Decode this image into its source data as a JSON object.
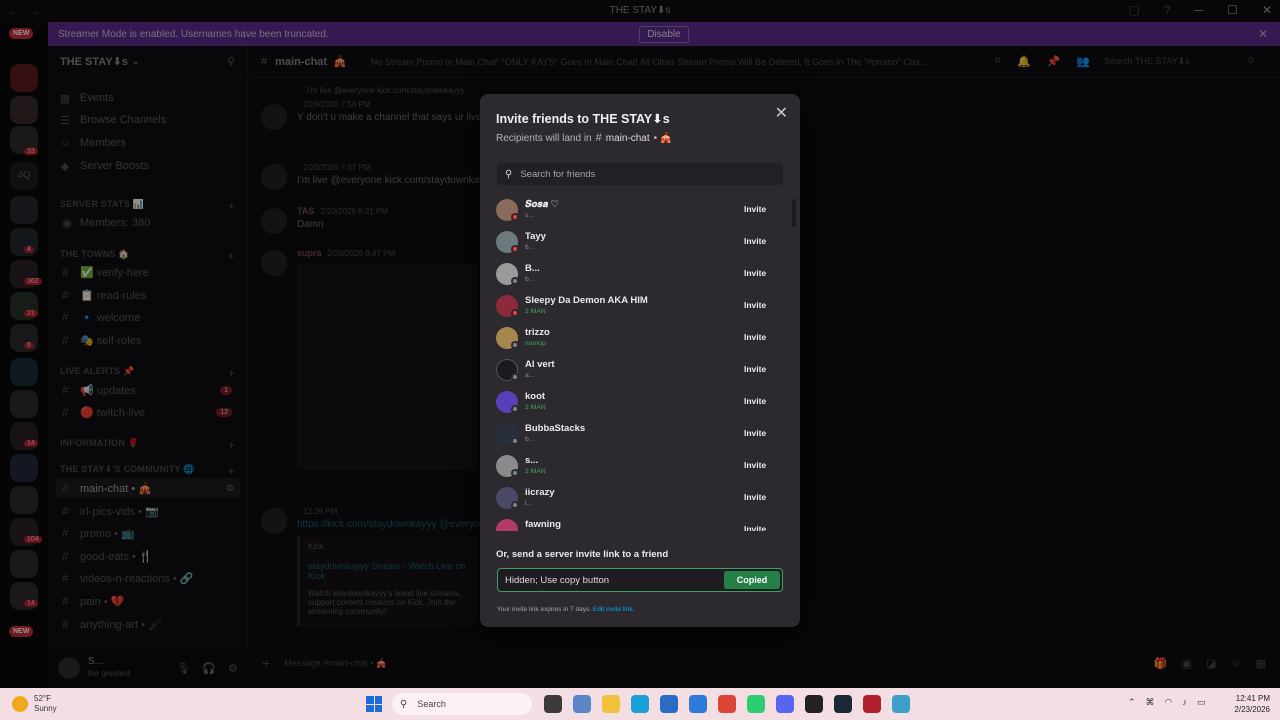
{
  "window": {
    "title": "THE STAY⬇s",
    "streamer_banner": "Streamer Mode is enabled. Usernames have been truncated.",
    "disable_label": "Disable"
  },
  "server": {
    "name": "THE STAY⬇s",
    "nav": [
      {
        "icon": "calendar-icon",
        "label": "Events"
      },
      {
        "icon": "browse-icon",
        "label": "Browse Channels"
      },
      {
        "icon": "members-icon",
        "label": "Members"
      },
      {
        "icon": "boost-icon",
        "label": "Server Boosts"
      }
    ],
    "categories": [
      {
        "label": "SERVER STATS 📊",
        "channels": [
          {
            "label": "Members: 380",
            "badge": ""
          }
        ]
      },
      {
        "label": "THE TOWNS 🏠",
        "channels": [
          {
            "label": "✅ verify-here",
            "badge": ""
          },
          {
            "label": "📋 read-rules",
            "badge": ""
          },
          {
            "label": "🔹 welcome",
            "badge": ""
          },
          {
            "label": "🎭 self-roles",
            "badge": ""
          }
        ]
      },
      {
        "label": "LIVE ALERTS 📌",
        "channels": [
          {
            "label": "📢 updates",
            "badge": "1"
          },
          {
            "label": "🔴 twitch-live",
            "badge": "12"
          }
        ]
      },
      {
        "label": "INFORMATION 🌹",
        "channels": []
      },
      {
        "label": "THE STAY⬇'S COMMUNITY 🌐",
        "channels": [
          {
            "label": "main-chat • 🎪",
            "badge": ""
          },
          {
            "label": "irl-pics-vids • 📷",
            "badge": ""
          },
          {
            "label": "promo • 📺",
            "badge": ""
          },
          {
            "label": "good-eats • 🍴",
            "badge": ""
          },
          {
            "label": "videos-n-reactions • 🔗",
            "badge": ""
          },
          {
            "label": "pain • 💔",
            "badge": ""
          },
          {
            "label": "anything-art • 🖌",
            "badge": ""
          }
        ]
      }
    ],
    "user": {
      "name": "S...",
      "status": "the greatest"
    }
  },
  "rail": {
    "badges": [
      "33",
      "4Q",
      "4",
      "362",
      "21",
      "6",
      "14",
      "104",
      "14"
    ],
    "new_label": "NEW"
  },
  "channel": {
    "name": "main-chat",
    "emoji": "🎪",
    "topic": "No Stream Promo In Main Chat! *ONLY KAYS* Goes In Main Chat! All Other Stream Promo Will Be Deleted, It Goes In The \"#promo\" Channel...",
    "search_placeholder": "Search THE STAY⬇s",
    "composer_placeholder": "Message #main-chat • 🎪"
  },
  "messages": [
    {
      "author": "",
      "time": "2/19/2026 7:58 PM",
      "reply": "I'm live @everyone kick.com/staydownkayyy",
      "text": "Y don't u make a channel that says ur live"
    },
    {
      "author": "",
      "time": "2/20/2026 7:57 PM",
      "text": "I'm live @everyone kick.com/staydownkayyy"
    },
    {
      "author": "TAS",
      "time": "2/20/2026 8:21 PM",
      "text": "Damn"
    },
    {
      "author": "supra",
      "time": "2/20/2026 8:47 PM",
      "text": ""
    },
    {
      "author": "",
      "time": "12:26 PM",
      "text": "https://kick.com/staydownkayyy @everyone"
    }
  ],
  "embed": {
    "provider": "Kick",
    "title": "staydownkayyy Stream - Watch Live on Kick",
    "desc": "Watch staydownkayyy's latest live streams, support content creators on Kick. Join the streaming community!"
  },
  "modal": {
    "title": "Invite friends to THE STAY⬇s",
    "recipients_prefix": "Recipients will land in",
    "channel": "main-chat",
    "channel_suffix": "• 🎪",
    "search_placeholder": "Search for friends",
    "invite_label": "Invite",
    "friends": [
      {
        "name": "𝑺𝒐𝒔𝒂 ♡",
        "sub": "s...",
        "status": "dnd",
        "color": "#8a6a5a",
        "green": false
      },
      {
        "name": "Tayy",
        "sub": "6...",
        "status": "dnd",
        "color": "#6b7a7d",
        "green": false
      },
      {
        "name": "B...",
        "sub": "b...",
        "status": "offline",
        "color": "#9a9a9a",
        "green": false
      },
      {
        "name": "Sleepy Da Demon AKA HIM",
        "sub": "2 MAN",
        "status": "dnd",
        "color": "#8b2b3a",
        "green": true
      },
      {
        "name": "trizzo",
        "sub": "monop",
        "status": "offline",
        "color": "#a8874f",
        "green": true
      },
      {
        "name": "Al vert",
        "sub": "a...",
        "status": "offline",
        "color": "#1c1a1e",
        "green": false
      },
      {
        "name": "koot",
        "sub": "2 MAN",
        "status": "offline",
        "color": "#5b3fb8",
        "green": true
      },
      {
        "name": "BubbaStacks",
        "sub": "b...",
        "status": "offline",
        "color": "#27303a",
        "green": false
      },
      {
        "name": "s...",
        "sub": "2 MAN",
        "status": "offline",
        "color": "#8c8a8c",
        "green": true
      },
      {
        "name": "iicrazy",
        "sub": "i...",
        "status": "offline",
        "color": "#4a4a68",
        "green": false
      },
      {
        "name": "fawning",
        "sub": "",
        "status": "offline",
        "color": "#b23a6a",
        "green": false
      }
    ],
    "or_label": "Or, send a server invite link to a friend",
    "link_value": "Hidden; Use copy button",
    "copied_label": "Copied",
    "expire_text": "Your invite link expires in 7 days.",
    "edit_link": "Edit invite link."
  },
  "taskbar": {
    "temp": "52°F",
    "weather": "Sunny",
    "search_label": "Search",
    "time": "12:41 PM",
    "date": "2/23/2026"
  },
  "colors": {
    "accent_green": "#248046",
    "link_blue": "#00a8fc",
    "banner_purple": "#5b2d8a"
  }
}
